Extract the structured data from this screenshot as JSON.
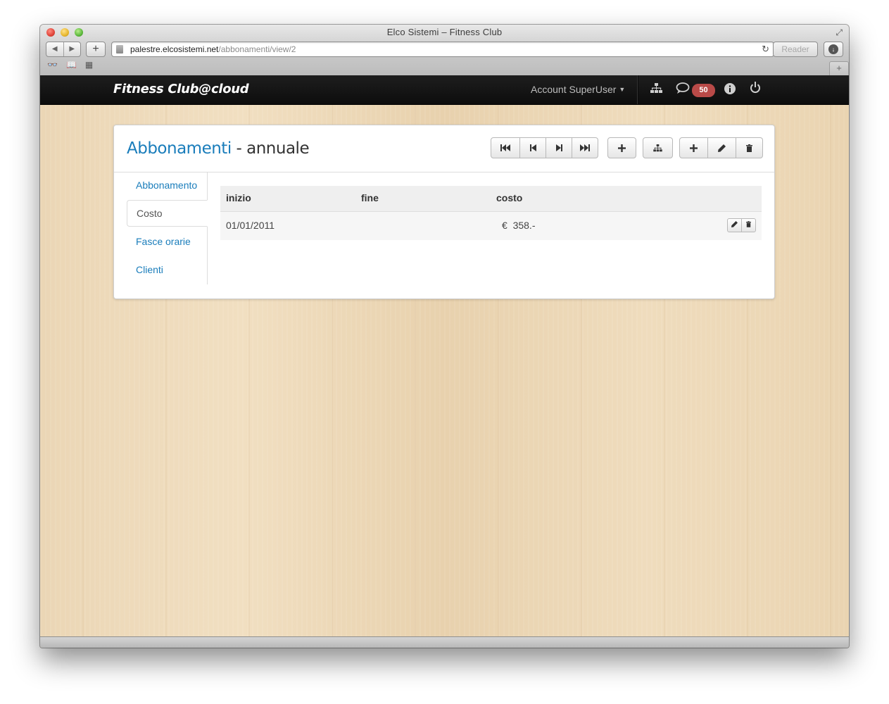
{
  "browser": {
    "window_title": "Elco Sistemi – Fitness Club",
    "url_host": "palestre.elcosistemi.net",
    "url_path": "/abbonamenti/view/2",
    "reader_label": "Reader"
  },
  "navbar": {
    "brand": "Fitness Club@cloud",
    "account_label": "Account SuperUser",
    "messages_count": "50"
  },
  "header": {
    "title_link": "Abbonamenti",
    "title_suffix": " - annuale"
  },
  "sidebar": {
    "items": [
      {
        "label": "Abbonamento",
        "active": false
      },
      {
        "label": "Costo",
        "active": true
      },
      {
        "label": "Fasce orarie",
        "active": false
      },
      {
        "label": "Clienti",
        "active": false
      }
    ]
  },
  "table": {
    "columns": [
      "inizio",
      "fine",
      "costo"
    ],
    "rows": [
      {
        "inizio": "01/01/2011",
        "fine": "",
        "costo": "€  358.-"
      }
    ]
  },
  "colors": {
    "link": "#1a7dbb",
    "navbar_bg": "#111111",
    "badge": "#b94a48"
  }
}
